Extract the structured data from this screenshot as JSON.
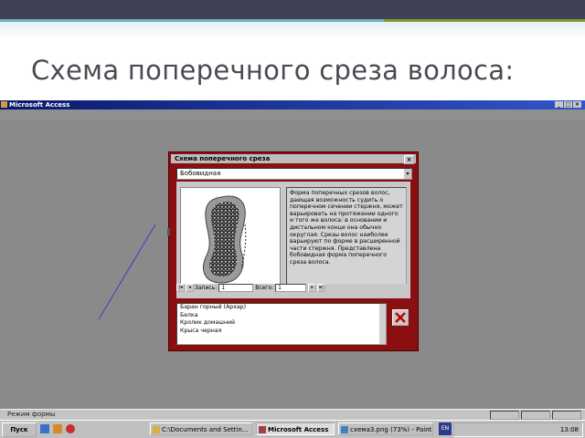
{
  "slide": {
    "title": "Схема поперечного среза волоса:"
  },
  "app": {
    "title": "Microsoft Access",
    "status": "Режим формы"
  },
  "form": {
    "title": "Схема поперечного среза",
    "combo_value": "Бобовидная",
    "description": "Форма поперечных срезов волос, дающая возможность судить о поперечном сечении стержня, может варьировать на протяжении одного и того же волоса: в основании и дистальном конце она обычно округлая. Срезы волос наиболее варьируют по форме в расширенной части стержня. Представлена бобовидная форма поперечного среза волоса.",
    "nav": {
      "record_label": "Запись:",
      "record_value": "1",
      "total_label": "Всего:",
      "total_value": "1"
    },
    "list_items": [
      "Баран горный (Архар)",
      "Белка",
      "Кролик домашний",
      "Крыса черная"
    ]
  },
  "taskbar": {
    "start": "Пуск",
    "tasks": [
      "C:\\Documents and Settin...",
      "Microsoft Access",
      "схема3.png (73%) - Paint..."
    ],
    "lang": "EN",
    "clock": "13:08"
  },
  "colors": {
    "form_bg": "#8b0f10",
    "title_bar": "#1a2f94",
    "desktop": "#8a8a8a"
  }
}
